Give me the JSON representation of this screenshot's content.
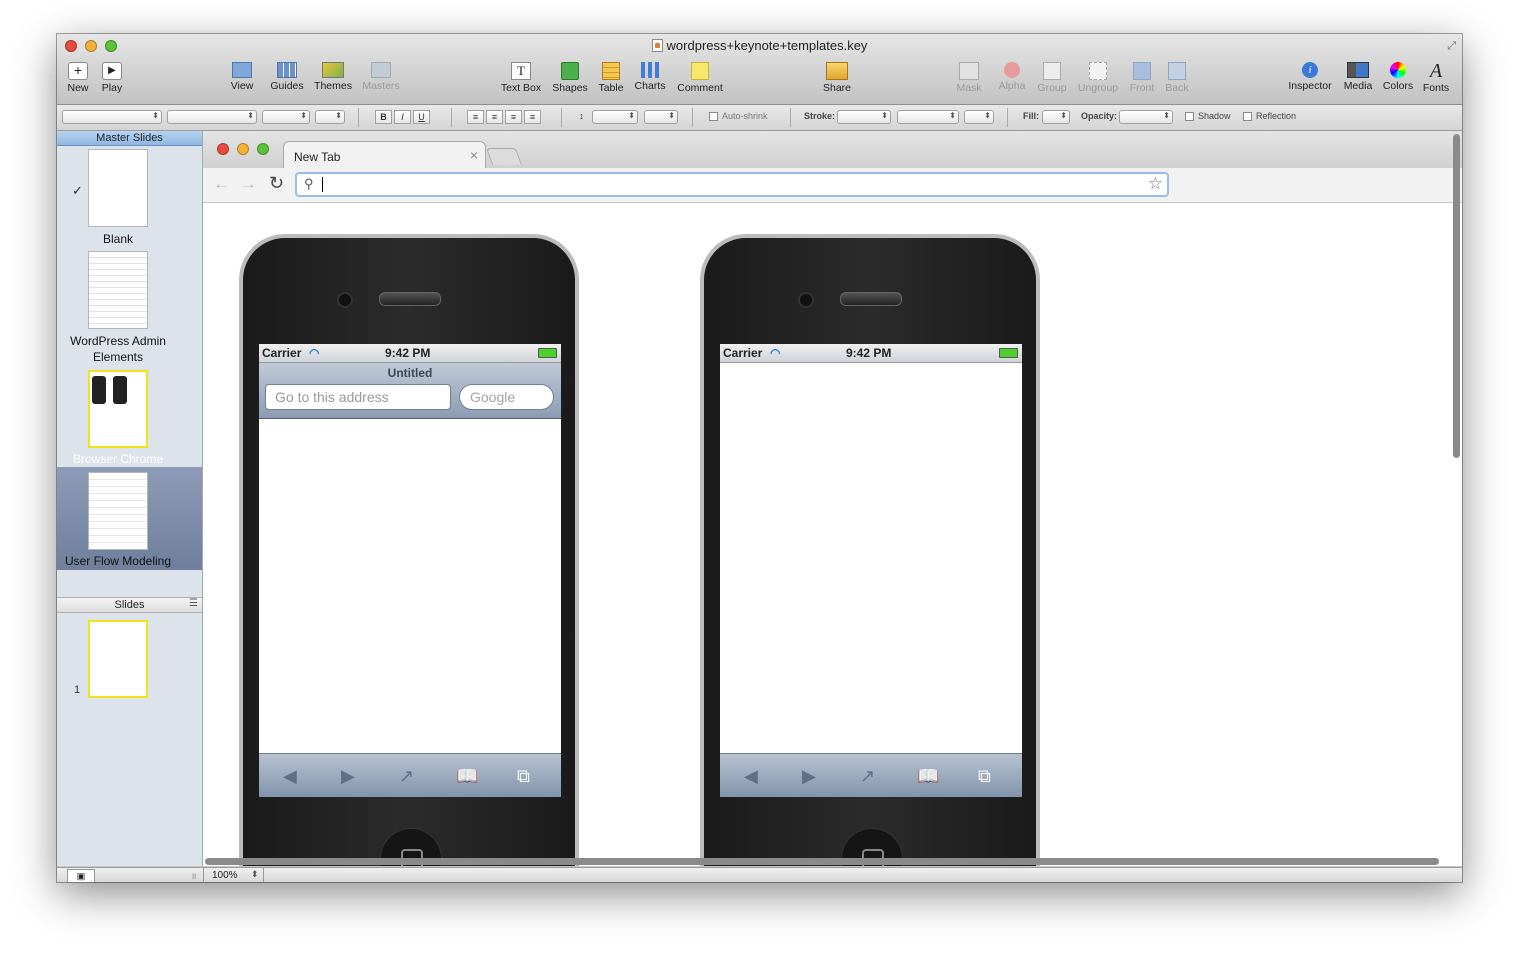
{
  "window": {
    "title": "wordpress+keynote+templates.key"
  },
  "toolbar": {
    "items": [
      {
        "label": "New"
      },
      {
        "label": "Play"
      },
      {
        "label": "View"
      },
      {
        "label": "Guides"
      },
      {
        "label": "Themes"
      },
      {
        "label": "Masters"
      },
      {
        "label": "Text Box"
      },
      {
        "label": "Shapes"
      },
      {
        "label": "Table"
      },
      {
        "label": "Charts"
      },
      {
        "label": "Comment"
      },
      {
        "label": "Share"
      },
      {
        "label": "Mask"
      },
      {
        "label": "Alpha"
      },
      {
        "label": "Group"
      },
      {
        "label": "Ungroup"
      },
      {
        "label": "Front"
      },
      {
        "label": "Back"
      },
      {
        "label": "Inspector"
      },
      {
        "label": "Media"
      },
      {
        "label": "Colors"
      },
      {
        "label": "Fonts"
      }
    ]
  },
  "format_bar": {
    "bold": "B",
    "italic": "I",
    "underline": "U",
    "auto_shrink": "Auto-shrink",
    "stroke": "Stroke:",
    "fill": "Fill:",
    "opacity": "Opacity:",
    "shadow": "Shadow",
    "reflection": "Reflection"
  },
  "sidebar": {
    "master_header": "Master Slides",
    "masters": [
      {
        "label": "Blank",
        "checked": true
      },
      {
        "label": "WordPress Admin Elements"
      },
      {
        "label": "Browser Chrome",
        "selected": true
      },
      {
        "label": "User Flow Modeling"
      }
    ],
    "slides_header": "Slides",
    "slides": [
      {
        "number": "1"
      }
    ]
  },
  "status": {
    "zoom": "100%"
  },
  "browser": {
    "tab_title": "New Tab",
    "close": "×"
  },
  "phones": [
    {
      "carrier": "Carrier",
      "time": "9:42 PM",
      "page_title": "Untitled",
      "address_placeholder": "Go to this address",
      "search_placeholder": "Google"
    },
    {
      "carrier": "Carrier",
      "time": "9:42 PM"
    }
  ]
}
